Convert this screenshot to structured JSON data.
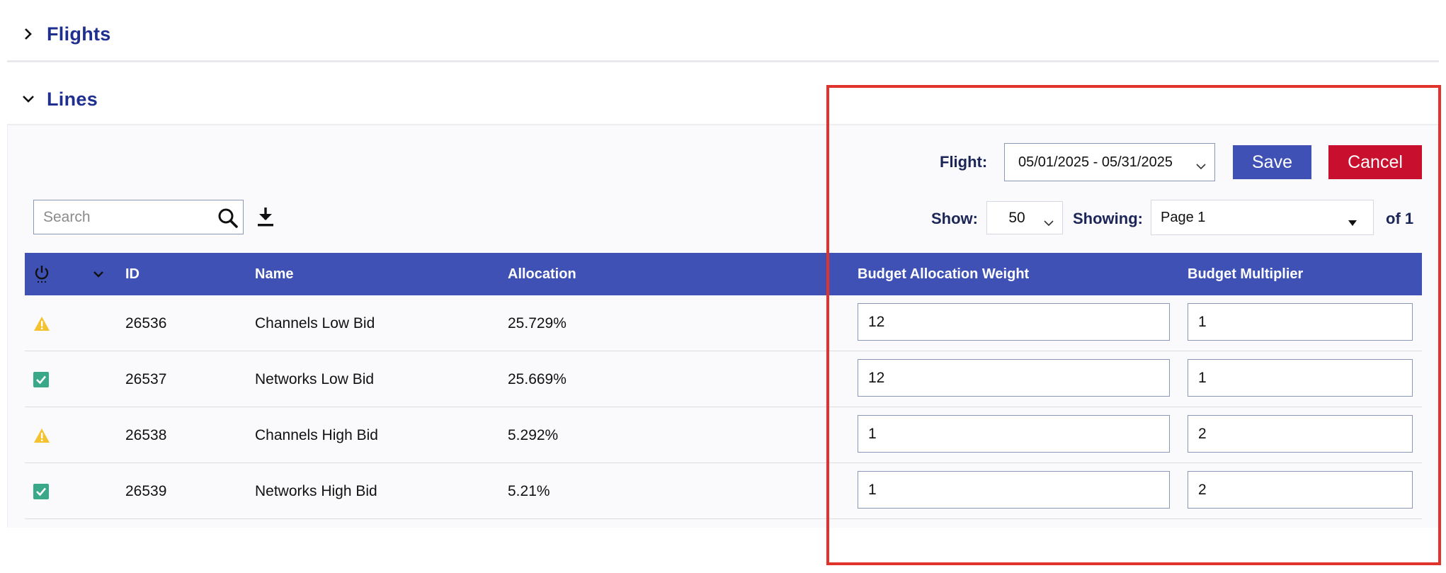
{
  "sections": {
    "flights": {
      "title": "Flights",
      "expanded": false
    },
    "lines": {
      "title": "Lines",
      "expanded": true
    }
  },
  "toolbar": {
    "flight_label": "Flight:",
    "flight_value": "05/01/2025 - 05/31/2025",
    "save_label": "Save",
    "cancel_label": "Cancel",
    "search_placeholder": "Search",
    "search_value": "",
    "show_label": "Show:",
    "show_value": "50",
    "showing_label": "Showing:",
    "page_value": "Page 1",
    "of_label": "of 1"
  },
  "table": {
    "columns": [
      "ID",
      "Name",
      "Allocation",
      "Budget Allocation Weight",
      "Budget Multiplier"
    ],
    "rows": [
      {
        "status": "warning",
        "id": "26536",
        "name": "Channels Low Bid",
        "allocation": "25.729%",
        "budget_allocation_weight": "12",
        "budget_multiplier": "1"
      },
      {
        "status": "checked",
        "id": "26537",
        "name": "Networks Low Bid",
        "allocation": "25.669%",
        "budget_allocation_weight": "12",
        "budget_multiplier": "1"
      },
      {
        "status": "warning",
        "id": "26538",
        "name": "Channels High Bid",
        "allocation": "5.292%",
        "budget_allocation_weight": "1",
        "budget_multiplier": "2"
      },
      {
        "status": "checked",
        "id": "26539",
        "name": "Networks High Bid",
        "allocation": "5.21%",
        "budget_allocation_weight": "1",
        "budget_multiplier": "2"
      }
    ]
  },
  "colors": {
    "section_title": "#1f2f8f",
    "table_header": "#3f51b5",
    "save_button": "#3f51b5",
    "cancel_button": "#c8102e",
    "warning_icon": "#f4c12f",
    "check_icon": "#3aa98a",
    "highlight": "#e0332b"
  },
  "icons": {
    "flights_toggle": "chevron-right-icon",
    "lines_toggle": "chevron-down-icon",
    "search": "search-icon",
    "download": "download-icon",
    "status_column": "power-icon",
    "sort": "chevron-down-icon"
  }
}
